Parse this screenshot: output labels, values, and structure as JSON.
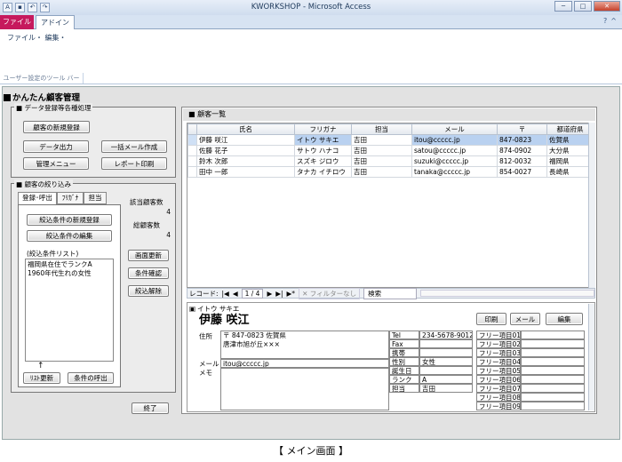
{
  "window": {
    "title": "KWORKSHOP - Microsoft Access"
  },
  "ribbon": {
    "tabs": [
      "ファイル",
      "アドイン"
    ],
    "menu": "ファイル・ 編集・",
    "group_label": "ユーザー設定のツール バー"
  },
  "form": {
    "title": "かんたん顧客管理",
    "data_group": {
      "title": "データ登録等各種処理",
      "new_customer": "顧客の新規登録",
      "data_output": "データ出力",
      "bulk_mail": "一括メール作成",
      "admin_menu": "管理メニュー",
      "report_print": "レポート印刷"
    },
    "filter_group": {
      "title": "顧客の絞り込み",
      "tabs": [
        "登録･呼出",
        "ﾌﾘｶﾞﾅ",
        "担当"
      ],
      "new_condition": "絞込条件の新規登録",
      "edit_condition": "絞込条件の編集",
      "list_label": "(絞込条件リスト)",
      "conditions": [
        "福岡県在住でランクA",
        "1960年代生れの女性"
      ],
      "arrow": "↑",
      "refresh_list": "ﾘｽﾄ更新",
      "call_condition": "条件の呼出"
    },
    "counts": {
      "matched_label": "該当顧客数",
      "matched_value": "4",
      "total_label": "総顧客数",
      "total_value": "4"
    },
    "side_buttons": [
      "画面更新",
      "条件確認",
      "絞込解除"
    ],
    "exit": "終了"
  },
  "list": {
    "title": "顧客一覧",
    "columns": [
      "氏名",
      "フリガナ",
      "担当",
      "メール",
      "〒",
      "都道府県"
    ],
    "rows": [
      [
        "伊藤 咲江",
        "イトウ サキエ",
        "吉田",
        "itou@ccccc.jp",
        "847-0823",
        "佐賀県"
      ],
      [
        "佐藤 花子",
        "サトウ ハナコ",
        "吉田",
        "satou@ccccc.jp",
        "874-0902",
        "大分県"
      ],
      [
        "鈴木 次郎",
        "スズキ ジロウ",
        "吉田",
        "suzuki@ccccc.jp",
        "812-0032",
        "福岡県"
      ],
      [
        "田中 一郎",
        "タナカ イチロウ",
        "吉田",
        "tanaka@ccccc.jp",
        "854-0027",
        "長崎県"
      ]
    ],
    "nav": {
      "label": "レコード:",
      "position": "1 / 4",
      "filter": "フィルターなし",
      "search": "検索"
    }
  },
  "detail": {
    "furigana": "イトウ サキエ",
    "name": "伊藤 咲江",
    "buttons": [
      "印刷",
      "メール",
      "編集"
    ],
    "address_label": "住所",
    "address_line1": "〒 847-0823 佐賀県",
    "address_line2": "唐津市旭が丘×××",
    "mail_label": "メール",
    "mail_value": "itou@ccccc.jp",
    "memo_label": "メモ",
    "fields": [
      {
        "label": "Tel",
        "value": "234-5678-9012"
      },
      {
        "label": "Fax",
        "value": ""
      },
      {
        "label": "携帯",
        "value": ""
      },
      {
        "label": "性別",
        "value": "女性"
      },
      {
        "label": "誕生日",
        "value": ""
      },
      {
        "label": "ランク",
        "value": "A"
      },
      {
        "label": "担当",
        "value": "吉田"
      }
    ],
    "free_items": [
      "フリー項目01",
      "フリー項目02",
      "フリー項目03",
      "フリー項目04",
      "フリー項目05",
      "フリー項目06",
      "フリー項目07",
      "フリー項目08",
      "フリー項目09"
    ]
  },
  "caption": "【 メイン画面 】"
}
